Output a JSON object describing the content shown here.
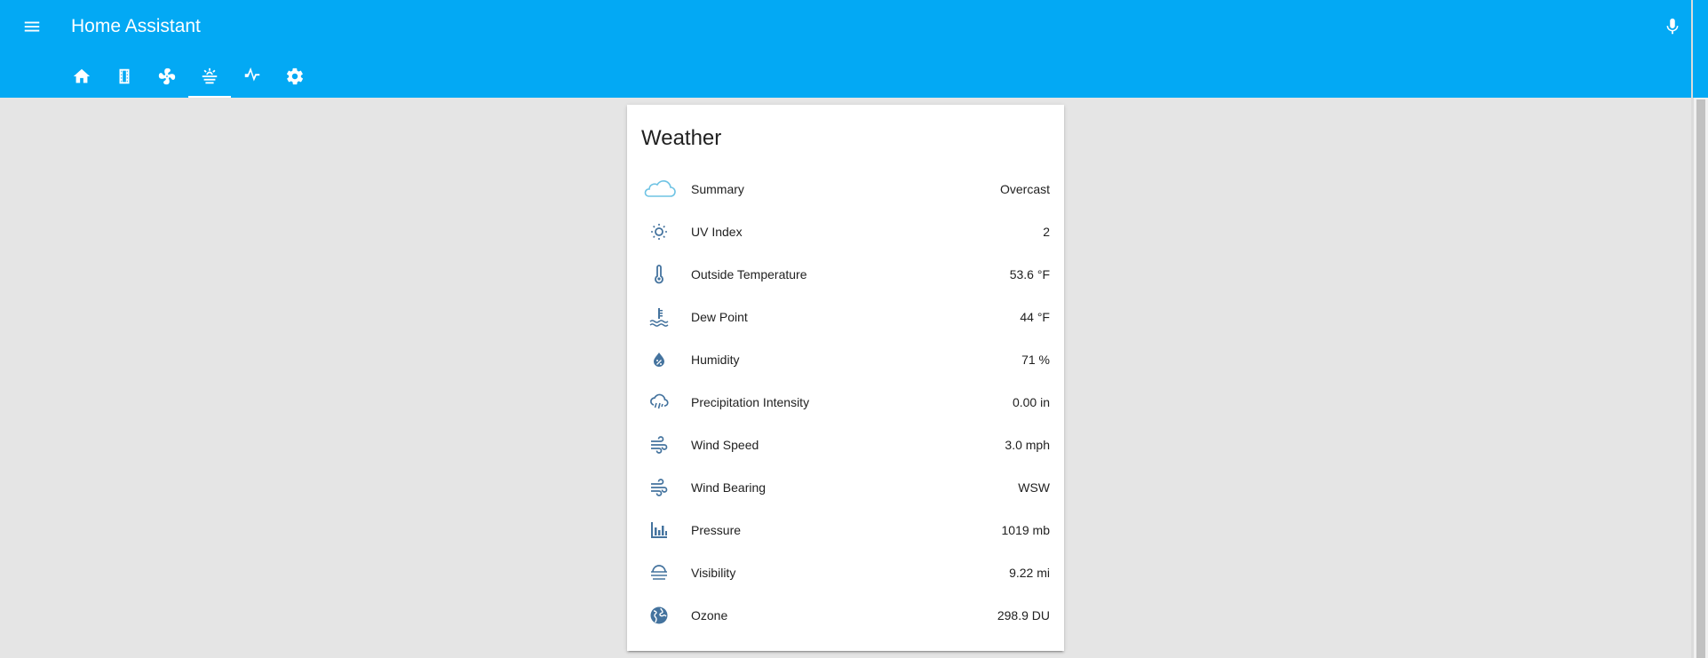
{
  "app": {
    "title": "Home Assistant"
  },
  "colors": {
    "toolbar": "#03a9f4",
    "icon": "#44739e",
    "cloud": "#6ec3e4",
    "background": "#e5e5e5"
  },
  "tabs": [
    {
      "icon": "home-icon",
      "active": false
    },
    {
      "icon": "film-icon",
      "active": false
    },
    {
      "icon": "fan-icon",
      "active": false
    },
    {
      "icon": "weather-fog-icon",
      "active": true
    },
    {
      "icon": "pulse-icon",
      "active": false
    },
    {
      "icon": "gear-icon",
      "active": false
    }
  ],
  "card": {
    "title": "Weather",
    "rows": [
      {
        "icon": "cloud-icon",
        "label": "Summary",
        "value": "Overcast"
      },
      {
        "icon": "sun-icon",
        "label": "UV Index",
        "value": "2"
      },
      {
        "icon": "thermometer-icon",
        "label": "Outside Temperature",
        "value": "53.6 °F"
      },
      {
        "icon": "coolant-temperature-icon",
        "label": "Dew Point",
        "value": "44 °F"
      },
      {
        "icon": "water-percent-icon",
        "label": "Humidity",
        "value": "71 %"
      },
      {
        "icon": "weather-rainy-icon",
        "label": "Precipitation Intensity",
        "value": "0.00 in"
      },
      {
        "icon": "wind-icon",
        "label": "Wind Speed",
        "value": "3.0 mph"
      },
      {
        "icon": "wind-icon",
        "label": "Wind Bearing",
        "value": "WSW"
      },
      {
        "icon": "bar-chart-icon",
        "label": "Pressure",
        "value": "1019 mb"
      },
      {
        "icon": "weather-fog-icon",
        "label": "Visibility",
        "value": "9.22 mi"
      },
      {
        "icon": "globe-icon",
        "label": "Ozone",
        "value": "298.9 DU"
      }
    ]
  }
}
